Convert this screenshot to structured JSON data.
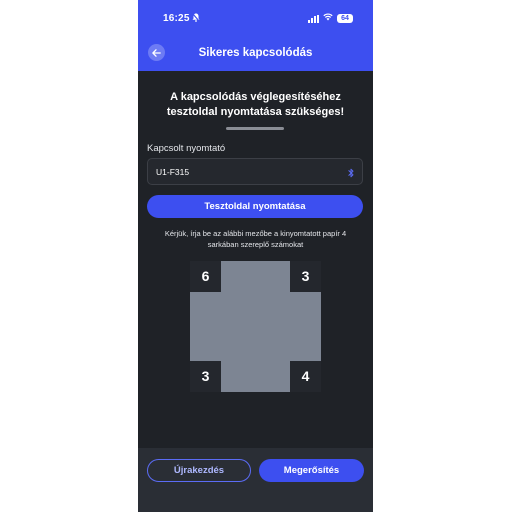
{
  "status_bar": {
    "time": "16:25",
    "battery": "64"
  },
  "nav": {
    "title": "Sikeres kapcsolódás"
  },
  "heading": {
    "line1": "A kapcsolódás véglegesítéséhez",
    "line2": "tesztoldal nyomtatása szükséges!"
  },
  "printer": {
    "label": "Kapcsolt nyomtató",
    "value": "U1-F315"
  },
  "buttons": {
    "print_test": "Tesztoldal nyomtatása",
    "restart": "Újrakezdés",
    "confirm": "Megerősítés"
  },
  "instructions": {
    "line1": "Kérjük, írja be az alábbi mezőbe a kinyomtatott papír 4",
    "line2": "sarkában szereplő számokat"
  },
  "corner_numbers": {
    "top_left": "6",
    "top_right": "3",
    "bottom_left": "3",
    "bottom_right": "4"
  },
  "icons": [
    "back-arrow-icon",
    "bell-muted-icon",
    "signal-icon",
    "wifi-icon",
    "battery-icon",
    "bluetooth-icon"
  ],
  "colors": {
    "accent": "#3d4ff0",
    "background": "#1f2227",
    "corner_box": "#24272d",
    "paper": "#7d8593"
  }
}
